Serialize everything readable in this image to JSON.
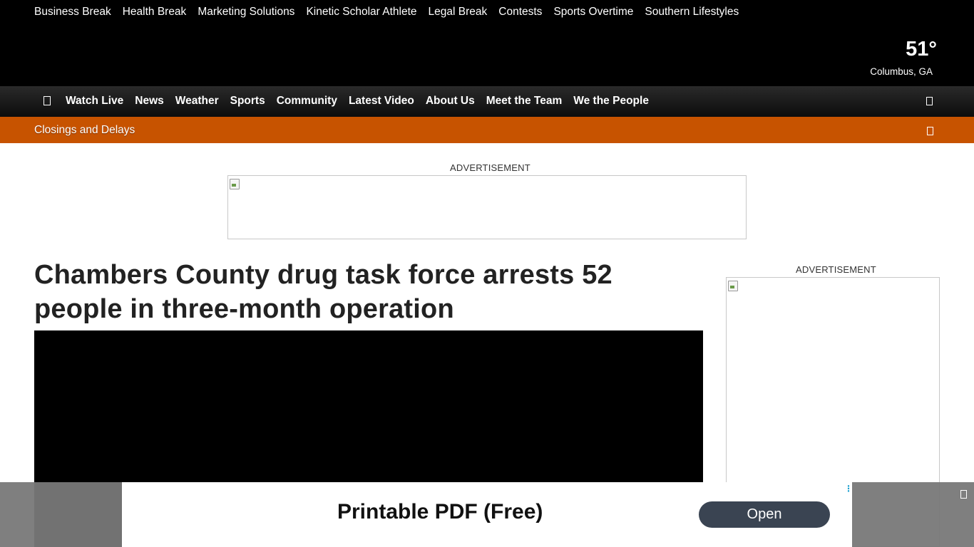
{
  "top_links": [
    "Business Break",
    "Health Break",
    "Marketing Solutions",
    "Kinetic Scholar Athlete",
    "Legal Break",
    "Contests",
    "Sports Overtime",
    "Southern Lifestyles"
  ],
  "weather": {
    "temperature": "51°",
    "location": "Columbus, GA"
  },
  "main_nav": [
    "Watch Live",
    "News",
    "Weather",
    "Sports",
    "Community",
    "Latest Video",
    "About Us",
    "Meet the Team",
    "We the People"
  ],
  "alert_bar": {
    "label": "Closings and Delays"
  },
  "ads": {
    "top_label": "ADVERTISEMENT",
    "side_label": "ADVERTISEMENT"
  },
  "article": {
    "headline": "Chambers County drug task force arrests 52 people in three-month operation"
  },
  "sticky_ad": {
    "title": "Printable PDF (Free)",
    "button": "Open",
    "adchoice": "⋮"
  },
  "colors": {
    "alert_bar": "#c75300",
    "header": "#000000",
    "button": "#3a4452"
  },
  "icons": {
    "menu": "menu-icon",
    "search": "search-icon",
    "close": "close-icon"
  }
}
